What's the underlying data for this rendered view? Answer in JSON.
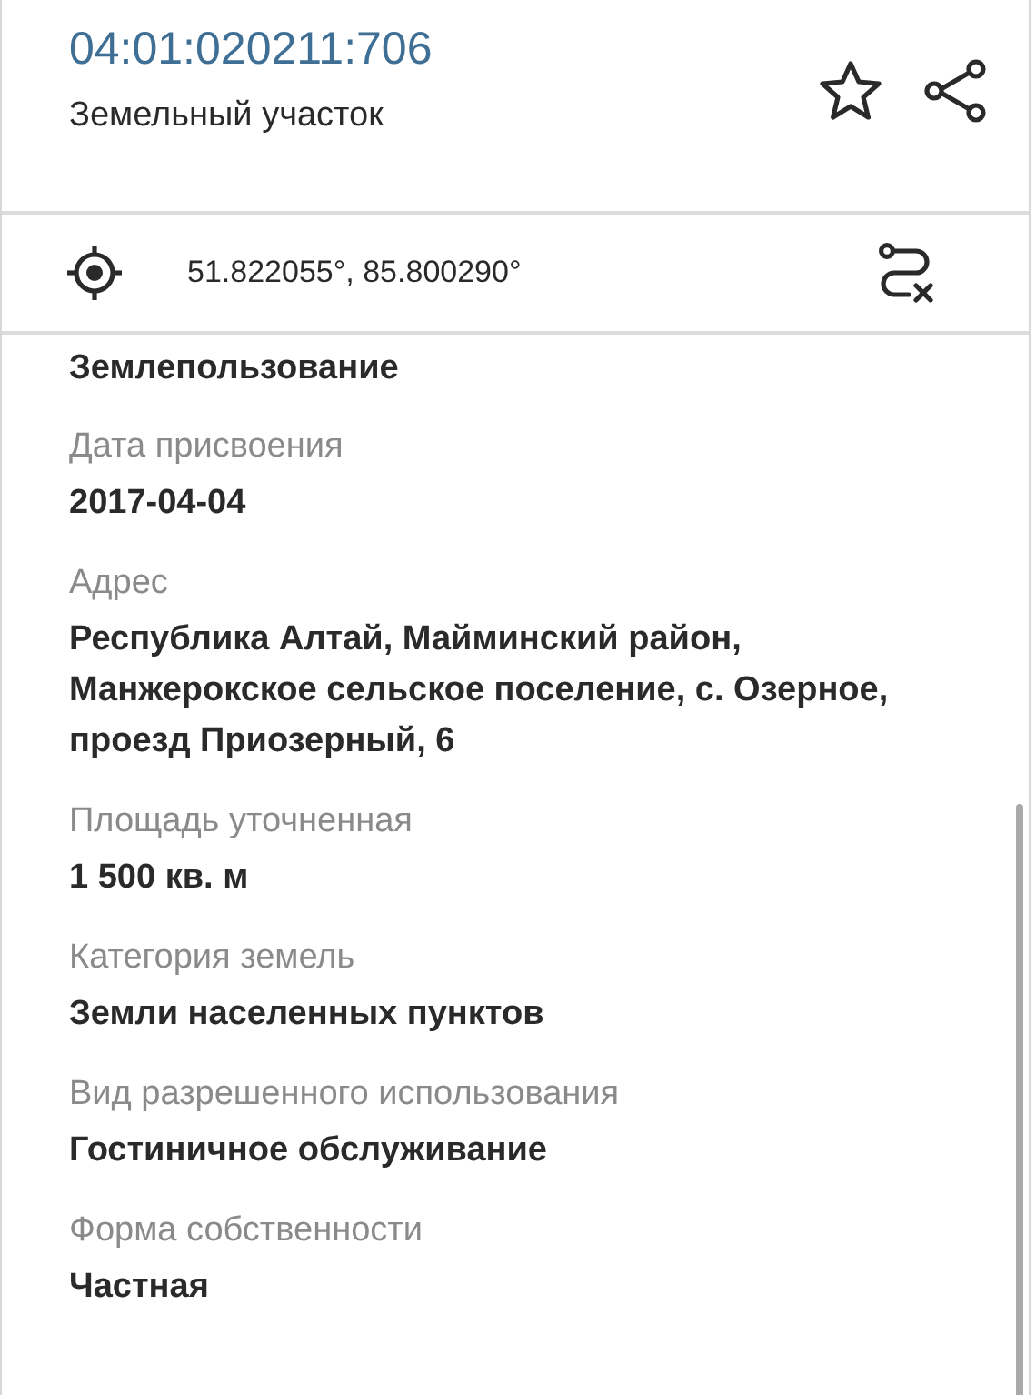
{
  "header": {
    "cadastral_number": "04:01:020211:706",
    "object_type": "Земельный участок"
  },
  "coordinates": "51.822055°, 85.800290°",
  "section_title": "Землепользование",
  "fields": [
    {
      "label": "Дата присвоения",
      "value": "2017-04-04"
    },
    {
      "label": "Адрес",
      "value": "Республика Алтай, Майминский район, Манжерокское сельское поселение, с. Озерное, проезд Приозерный, 6"
    },
    {
      "label": "Площадь уточненная",
      "value": "1 500 кв. м"
    },
    {
      "label": "Категория земель",
      "value": "Земли населенных пунктов"
    },
    {
      "label": "Вид разрешенного использования",
      "value": "Гостиничное обслуживание"
    },
    {
      "label": "Форма собственности",
      "value": "Частная"
    }
  ]
}
